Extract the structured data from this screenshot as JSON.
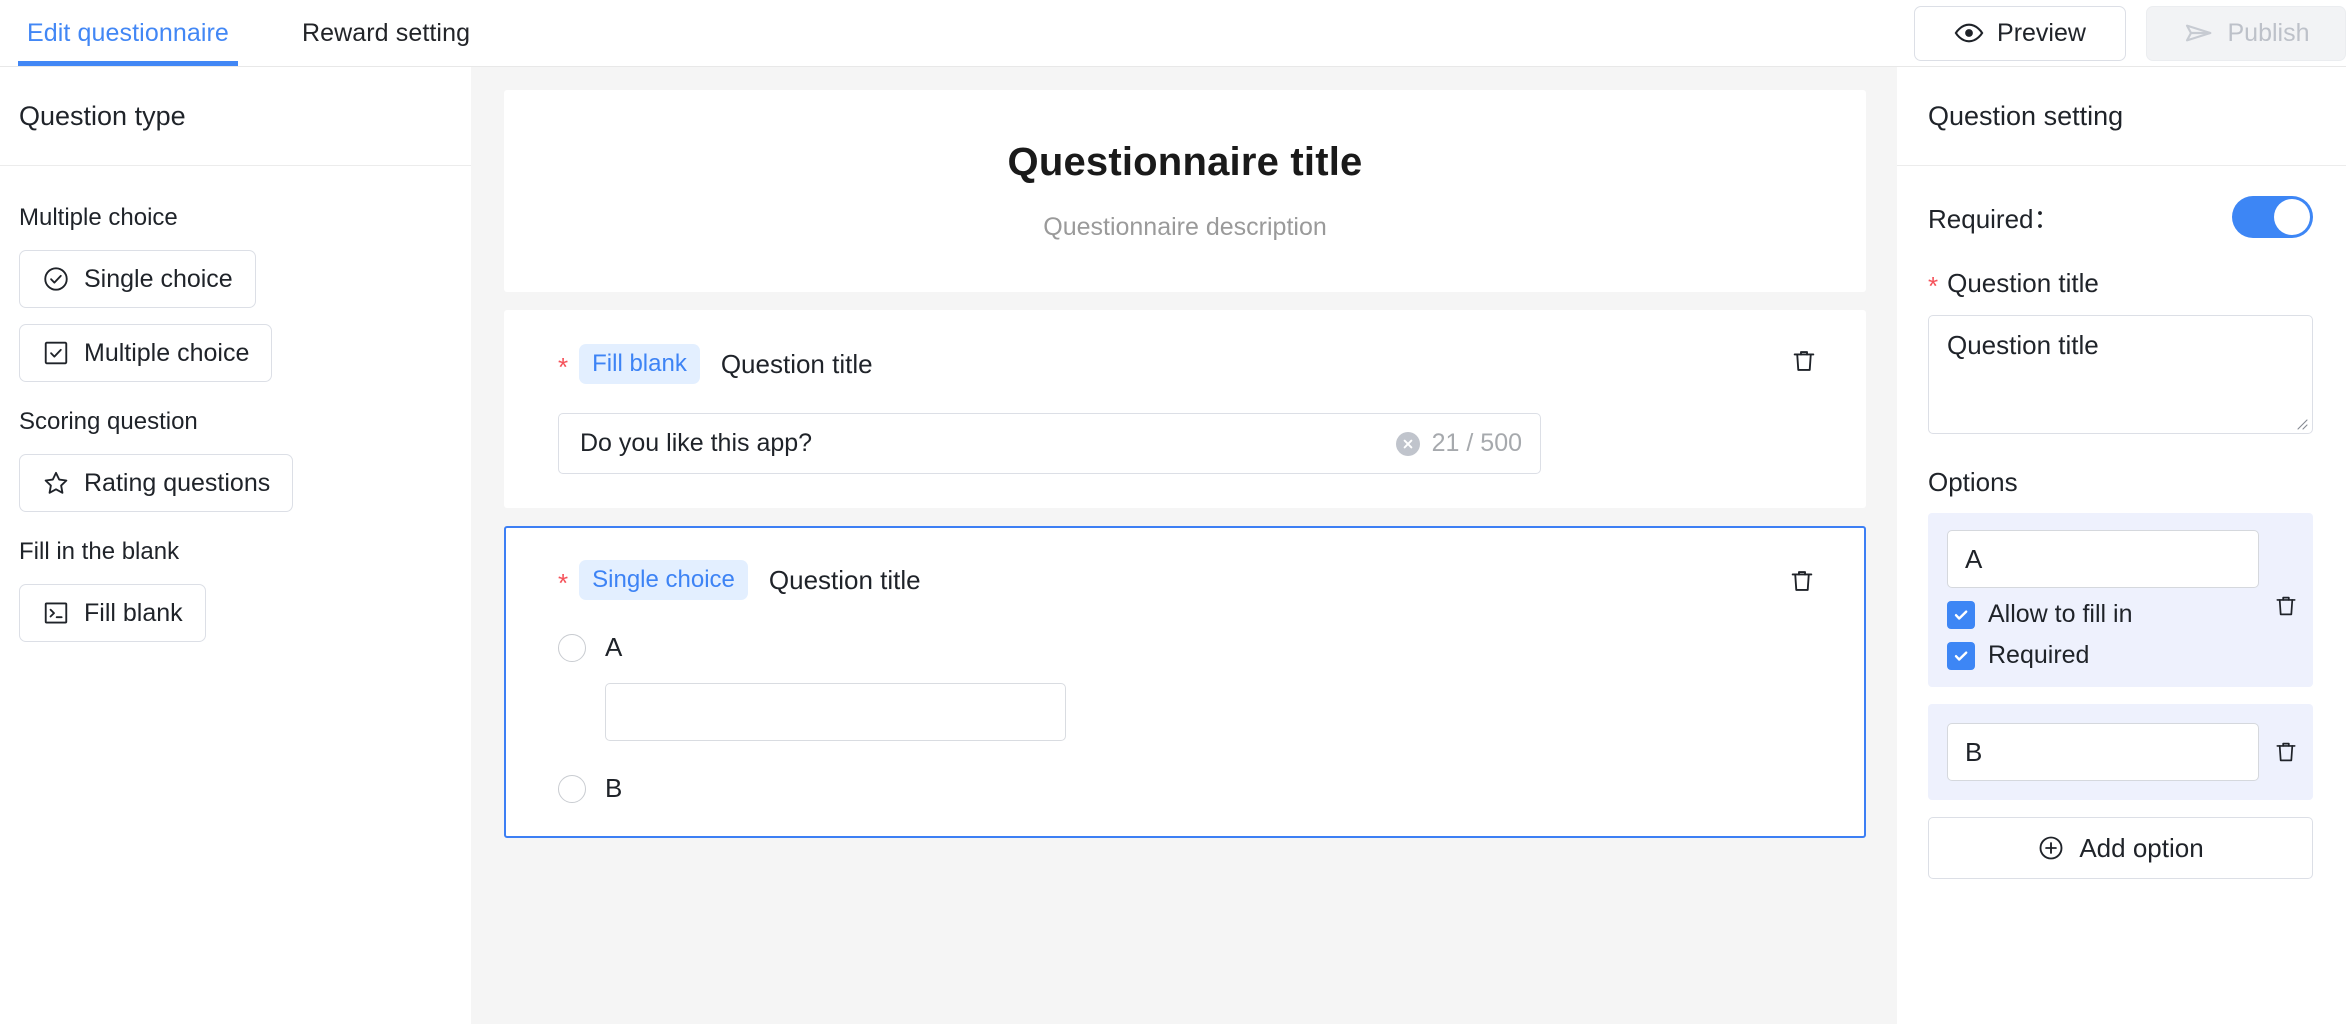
{
  "header": {
    "tabs": [
      {
        "label": "Edit questionnaire",
        "active": true
      },
      {
        "label": "Reward setting",
        "active": false
      }
    ],
    "actions": {
      "preview_label": "Preview",
      "preview_icon": "eye-icon",
      "publish_label": "Publish",
      "publish_icon": "send-icon",
      "publish_disabled": true
    }
  },
  "sidebar": {
    "title": "Question type",
    "groups": [
      {
        "label": "Multiple choice",
        "items": [
          {
            "label": "Single choice",
            "icon": "check-circle-icon"
          },
          {
            "label": "Multiple choice",
            "icon": "check-square-icon"
          }
        ]
      },
      {
        "label": "Scoring question",
        "items": [
          {
            "label": "Rating questions",
            "icon": "star-icon"
          }
        ]
      },
      {
        "label": "Fill in the blank",
        "items": [
          {
            "label": "Fill blank",
            "icon": "terminal-icon"
          }
        ]
      }
    ]
  },
  "center": {
    "questionnaire_title": "Questionnaire title",
    "questionnaire_description": "Questionnaire description",
    "questions": [
      {
        "required_star": "*",
        "badge": "Fill blank",
        "title": "Question title",
        "delete_icon": "trash-icon",
        "answer_value": "Do you like this app?",
        "char_counter": "21 / 500",
        "clear_icon": "clear-circle-icon",
        "selected": false
      },
      {
        "required_star": "*",
        "badge": "Single choice",
        "title": "Question title",
        "delete_icon": "trash-icon",
        "selected": true,
        "options": [
          {
            "label": "A",
            "has_fill_in": true
          },
          {
            "label": "B",
            "has_fill_in": false
          }
        ]
      }
    ]
  },
  "right_panel": {
    "title": "Question setting",
    "required_label": "Required：",
    "required_on": true,
    "question_title_label": "Question title",
    "question_title_star": "*",
    "question_title_value": "Question title",
    "options_label": "Options",
    "options": [
      {
        "value": "A",
        "checkboxes": [
          {
            "label": "Allow to fill in",
            "checked": true
          },
          {
            "label": "Required",
            "checked": true
          }
        ],
        "delete_icon": "trash-icon"
      },
      {
        "value": "B",
        "checkboxes": [],
        "delete_icon": "trash-icon"
      }
    ],
    "add_option_label": "Add option",
    "add_option_icon": "plus-circle-icon"
  },
  "colors": {
    "accent_blue": "#3d86f5",
    "tab_active": "#4287f5",
    "badge_bg": "#e3efff",
    "badge_text": "#3d83f5",
    "required_red": "#f5525a",
    "option_card_bg": "#eef1fd",
    "page_bg": "#f5f5f5"
  }
}
